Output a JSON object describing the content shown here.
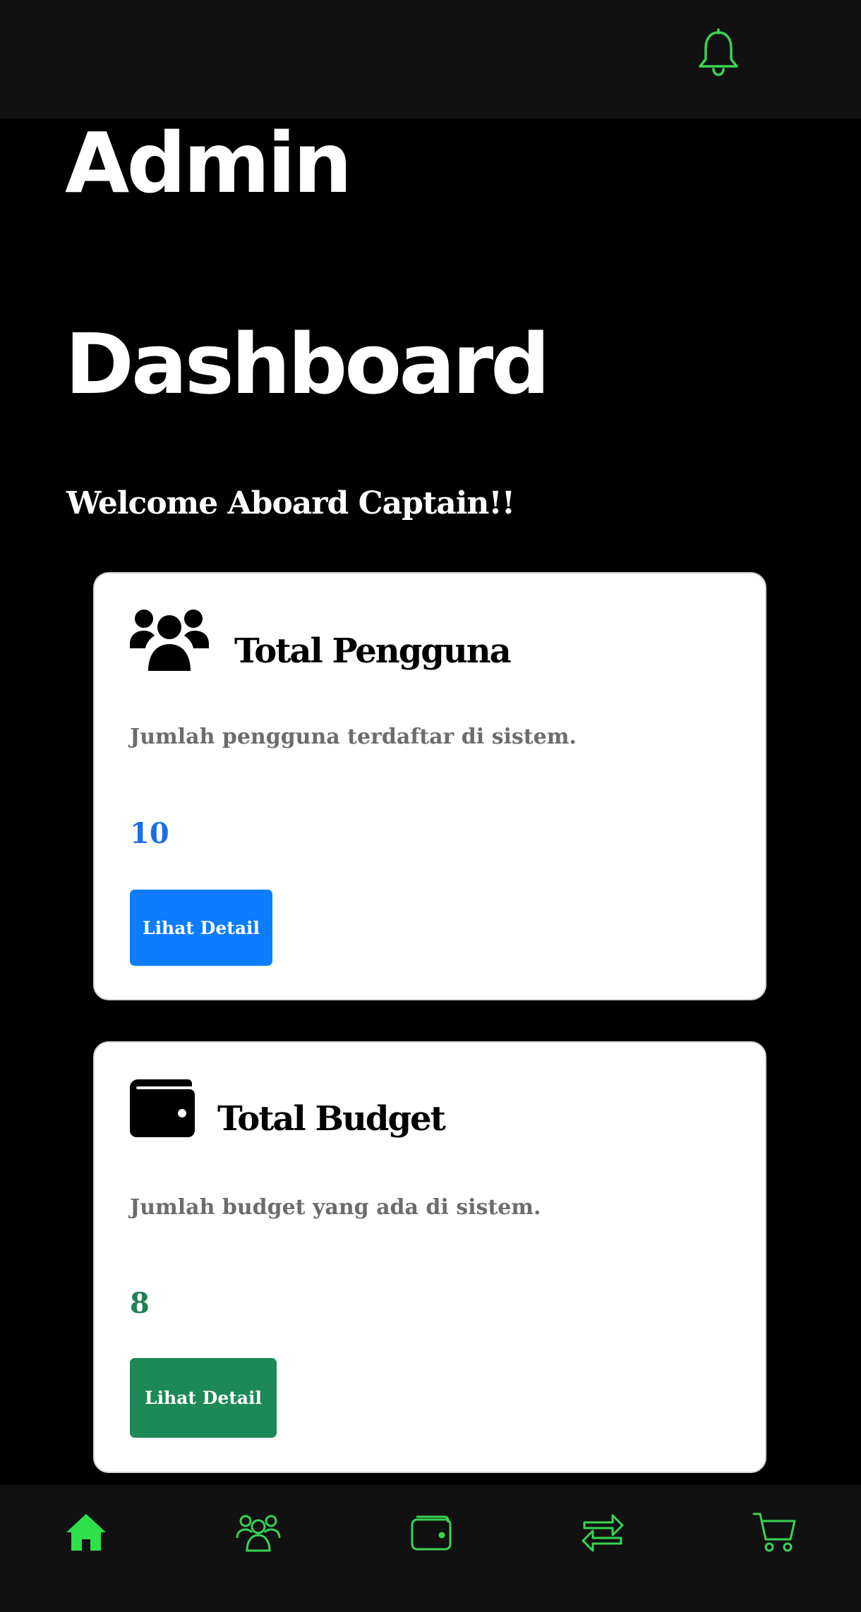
{
  "header": {
    "notification_icon": "bell-icon",
    "accent_color": "#39d353"
  },
  "page": {
    "title_line1": "Admin",
    "title_line2": "Dashboard",
    "welcome": "Welcome Aboard Captain!!"
  },
  "cards": [
    {
      "icon": "users-icon",
      "title": "Total Pengguna",
      "description": "Jumlah pengguna terdaftar di sistem.",
      "count": "10",
      "count_color": "#1a6fe8",
      "button_label": "Lihat Detail",
      "button_color": "#0d7cff"
    },
    {
      "icon": "wallet-icon",
      "title": "Total Budget",
      "description": "Jumlah budget yang ada di sistem.",
      "count": "8",
      "count_color": "#1f8152",
      "button_label": "Lihat Detail",
      "button_color": "#1d8956"
    }
  ],
  "bottom_nav": {
    "items": [
      {
        "icon": "home-icon",
        "active": true
      },
      {
        "icon": "users-icon",
        "active": false
      },
      {
        "icon": "wallet-icon",
        "active": false
      },
      {
        "icon": "transfer-arrows-icon",
        "active": false
      },
      {
        "icon": "cart-icon",
        "active": false
      }
    ]
  }
}
